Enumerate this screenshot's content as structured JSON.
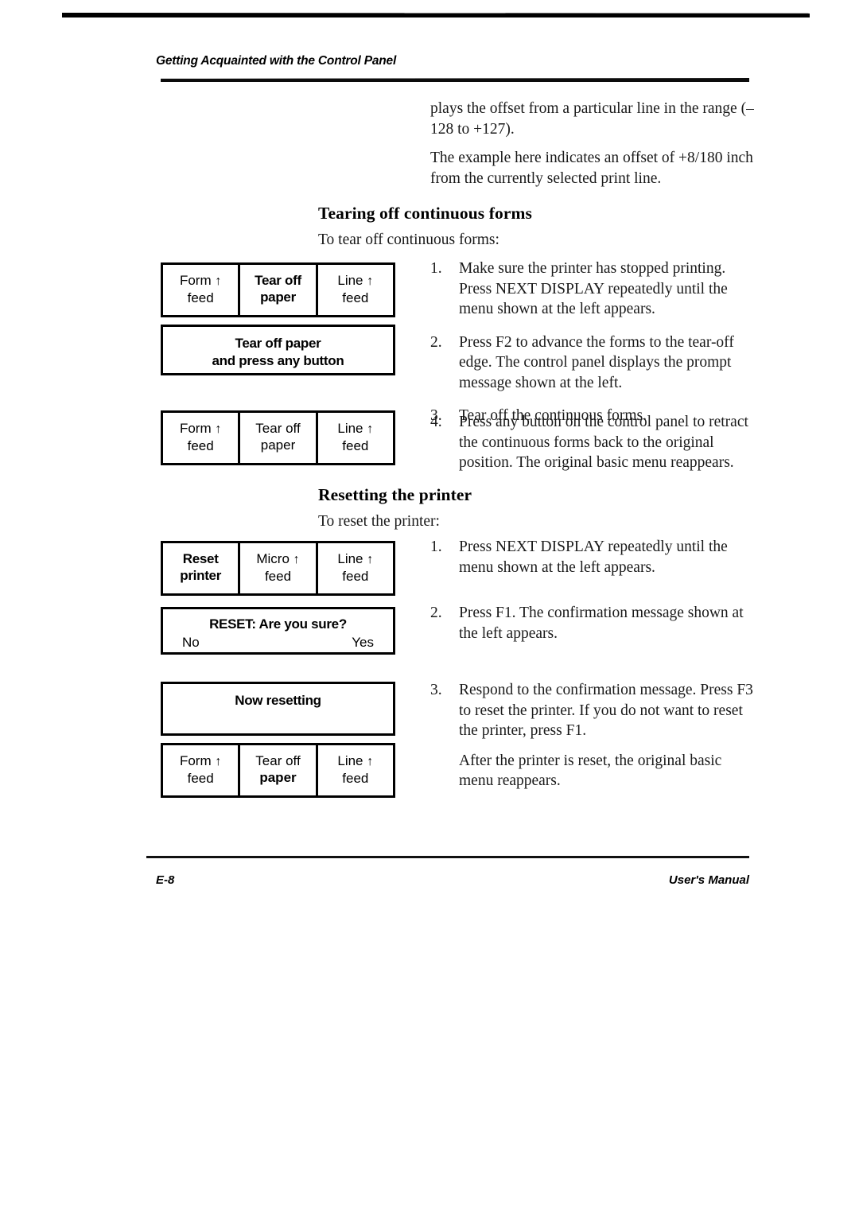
{
  "page": {
    "running_head": "Getting Acquainted with the Control Panel",
    "folio": "E-8",
    "manual_title": "User's Manual"
  },
  "intro": {
    "para1": "plays the offset from a particular line in the range (–128 to +127).",
    "para2": "The example here indicates an offset of +8/180 inch from the currently selected print line."
  },
  "tearing": {
    "heading": "Tearing off continuous forms",
    "lead": "To tear off continuous forms:",
    "steps": [
      {
        "num": "1.",
        "text": "Make sure the printer has stopped printing. Press NEXT DISPLAY repeatedly until the menu shown at the left appears."
      },
      {
        "num": "2.",
        "text": "Press F2 to advance the forms to the tear-off edge. The control panel displays the prompt message shown at the left."
      },
      {
        "num": "3.",
        "text": "Tear off the continuous forms."
      },
      {
        "num": "4.",
        "text": "Press any button on the control panel to retract the continuous forms back to the original position. The original basic menu reappears."
      }
    ],
    "panel_menu_highlighted": {
      "cells": [
        {
          "line1": "Form",
          "arrow": "↑",
          "line2": "feed",
          "highlighted": false
        },
        {
          "line1": "Tear off",
          "arrow": "",
          "line2": "paper",
          "highlighted": true
        },
        {
          "line1": "Line",
          "arrow": "↑",
          "line2": "feed",
          "highlighted": false
        }
      ]
    },
    "panel_prompt": {
      "lines": [
        "Tear off paper",
        "and press any button"
      ]
    },
    "panel_menu_plain": {
      "cells": [
        {
          "line1": "Form",
          "arrow": "↑",
          "line2": "feed",
          "highlighted": false
        },
        {
          "line1": "Tear off",
          "arrow": "",
          "line2": "paper",
          "highlighted": false
        },
        {
          "line1": "Line",
          "arrow": "↑",
          "line2": "feed",
          "highlighted": false
        }
      ]
    }
  },
  "resetting": {
    "heading": "Resetting the printer",
    "lead": "To reset the printer:",
    "steps": [
      {
        "num": "1.",
        "text": "Press NEXT DISPLAY repeatedly until the menu shown at the left appears."
      },
      {
        "num": "2.",
        "text": "Press F1. The confirmation message shown at the left appears."
      },
      {
        "num": "3.",
        "text": "Respond to the confirmation message. Press F3 to reset the printer. If you do not want to reset the printer, press F1."
      }
    ],
    "closing_para": "After the printer is reset, the original basic menu reappears.",
    "panel_reset_menu": {
      "cells": [
        {
          "line1": "Reset",
          "arrow": "",
          "line2": "printer",
          "highlighted": true
        },
        {
          "line1": "Micro",
          "arrow": "↑",
          "line2": "feed",
          "highlighted": false
        },
        {
          "line1": "Line",
          "arrow": "↑",
          "line2": "feed",
          "highlighted": false
        }
      ]
    },
    "panel_confirm": {
      "title": "RESET: Are you sure?",
      "no_label": "No",
      "yes_label": "Yes"
    },
    "panel_busy": {
      "line": "Now resetting"
    },
    "panel_basic_menu": {
      "cells": [
        {
          "line1": "Form",
          "arrow": "↑",
          "line2": "feed",
          "highlighted": false
        },
        {
          "line1": "Tear off",
          "arrow": "",
          "line2": "paper",
          "highlighted": true
        },
        {
          "line1": "Line",
          "arrow": "↑",
          "line2": "feed",
          "highlighted": false
        }
      ]
    }
  }
}
